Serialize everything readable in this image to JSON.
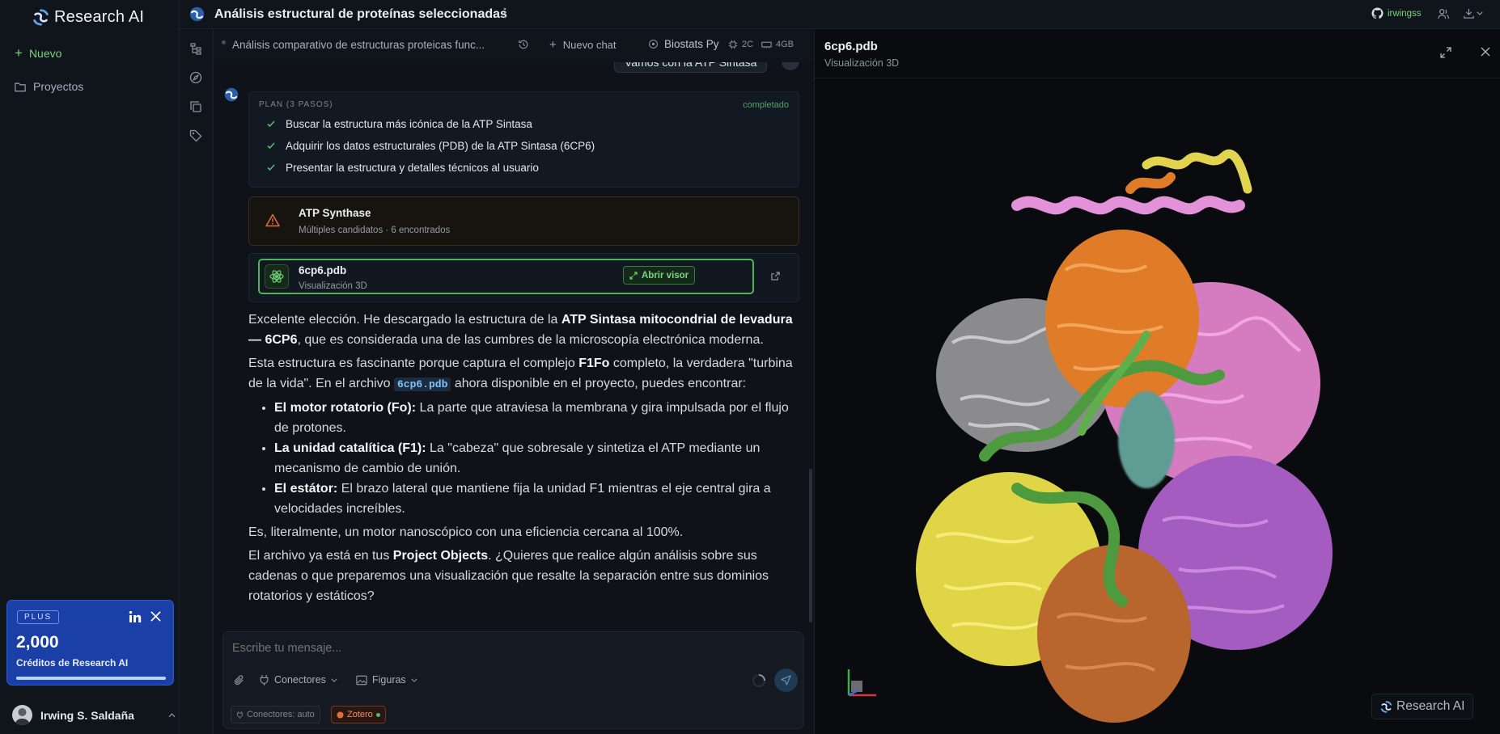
{
  "app": {
    "name": "Research AI"
  },
  "sidebar": {
    "new_label": "Nuevo",
    "projects_label": "Proyectos"
  },
  "plan_card": {
    "badge": "PLUS",
    "credits": "2,000",
    "credits_label": "Créditos de Research AI",
    "credits_fill": 1.0
  },
  "user": {
    "name": "Irwing S. Saldaña"
  },
  "topbar": {
    "title": "Análisis estructural de proteínas seleccionadas",
    "github_user": "irwingss"
  },
  "chatbar": {
    "chat_title": "Análisis comparativo de estructuras proteicas func...",
    "new_chat": "Nuevo chat",
    "env_name": "Biostats Py",
    "cpu": "2C",
    "ram": "4GB"
  },
  "chat": {
    "user_msg": "Vamos con la ATP Sintasa",
    "plan": {
      "header": "PLAN (3 PASOS)",
      "status": "completado",
      "steps": [
        "Buscar la estructura más icónica de la ATP Sintasa",
        "Adquirir los datos estructurales (PDB) de la ATP Sintasa (6CP6)",
        "Presentar la estructura y detalles técnicos al usuario"
      ]
    },
    "warning": {
      "title": "ATP Synthase",
      "subtitle": "Múltiples candidatos · 6 encontrados"
    },
    "file": {
      "name": "6cp6.pdb",
      "subtitle": "Visualización 3D",
      "open_label": "Abrir visor"
    },
    "response": {
      "p1_a": "Excelente elección. He descargado la estructura de la ",
      "p1_b": "ATP Sintasa mitocondrial de levadura — 6CP6",
      "p1_c": ", que es considerada una de las cumbres de la microscopía electrónica moderna.",
      "p2_a": "Esta estructura es fascinante porque captura el complejo ",
      "p2_b": "F1Fo",
      "p2_c": " completo, la verdadera \"turbina de la vida\". En el archivo ",
      "p2_code": "6cp6.pdb",
      "p2_d": " ahora disponible en el proyecto, puedes encontrar:",
      "bullets": [
        {
          "head": "El motor rotatorio (Fo):",
          "text": " La parte que atraviesa la membrana y gira impulsada por el flujo de protones."
        },
        {
          "head": "La unidad catalítica (F1):",
          "text": " La \"cabeza\" que sobresale y sintetiza el ATP mediante un mecanismo de cambio de unión."
        },
        {
          "head": "El estátor:",
          "text": " El brazo lateral que mantiene fija la unidad F1 mientras el eje central gira a velocidades increíbles."
        }
      ],
      "p3": "Es, literalmente, un motor nanoscópico con una eficiencia cercana al 100%.",
      "p4_a": "El archivo ya está en tus ",
      "p4_b": "Project Objects",
      "p4_c": ". ¿Quieres que realice algún análisis sobre sus cadenas o que preparemos una visualización que resalte la separación entre sus dominios rotatorios y estáticos?"
    }
  },
  "composer": {
    "placeholder": "Escribe tu mensaje...",
    "connectors_label": "Conectores",
    "figures_label": "Figuras",
    "connectors_chip": "Conectores: auto",
    "zotero_chip": "Zotero"
  },
  "viewer": {
    "title": "6cp6.pdb",
    "subtitle": "Visualización 3D",
    "watermark": "Research AI"
  },
  "colors": {
    "accent_green": "#6fcf73",
    "warning": "#e0703a",
    "plus_blue": "#1a3fa6"
  }
}
